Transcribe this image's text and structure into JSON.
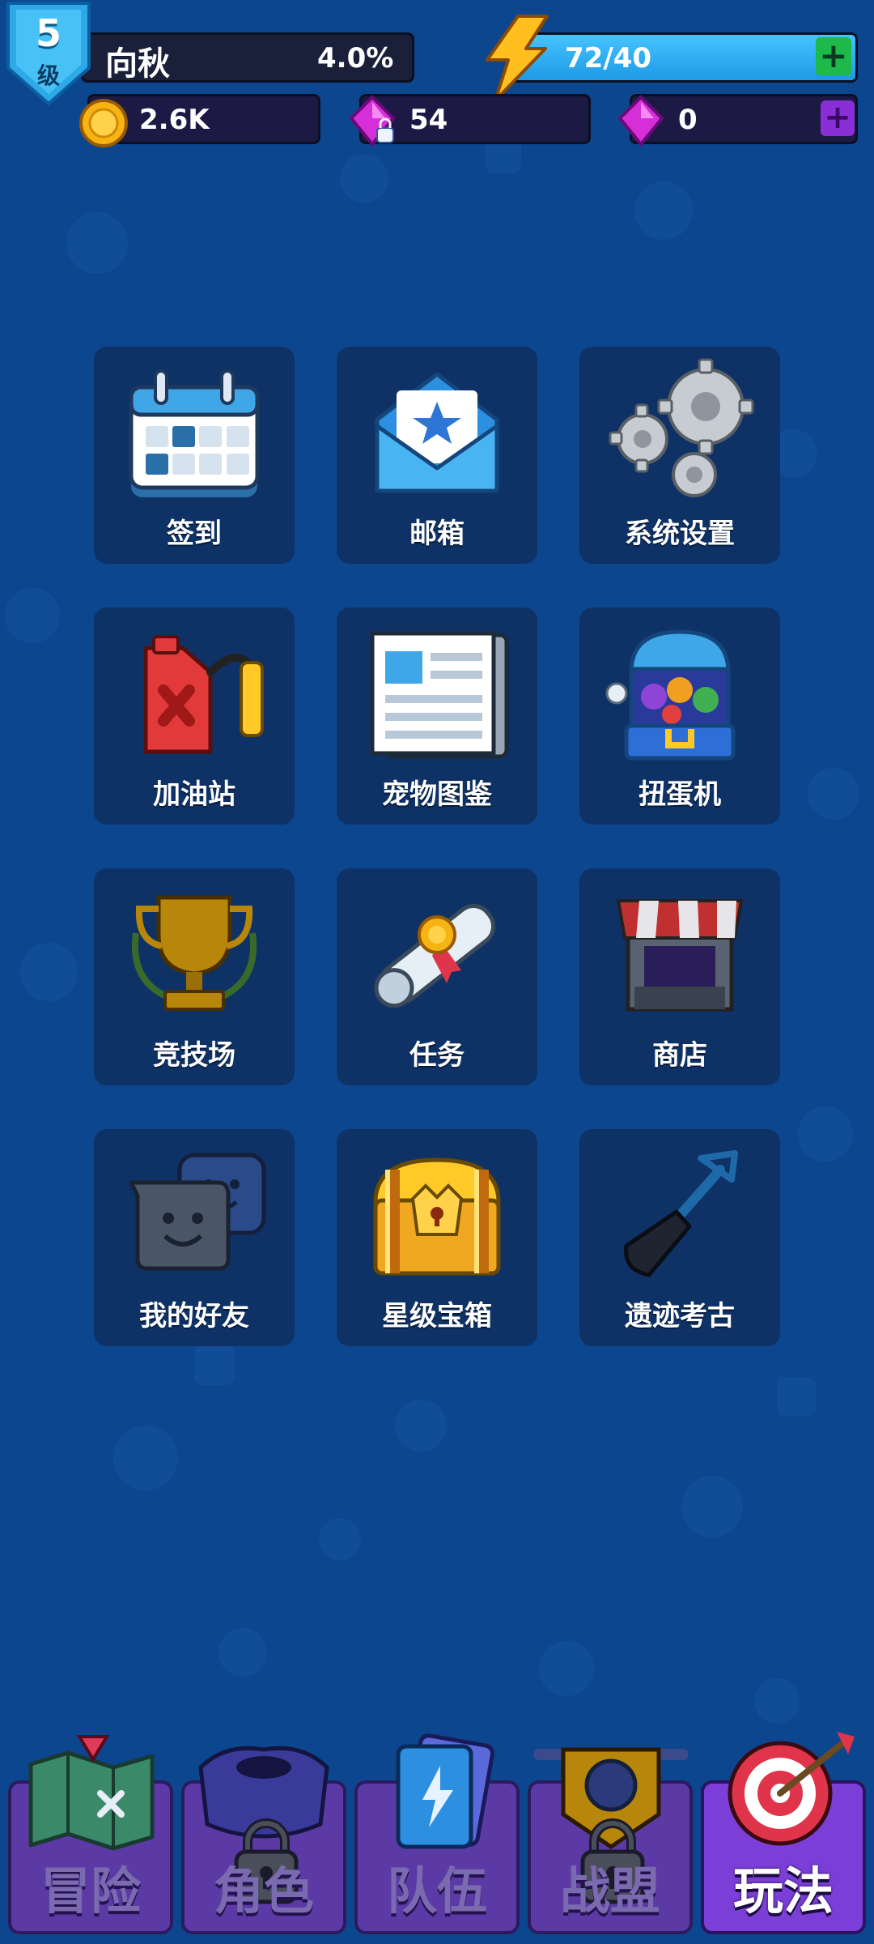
{
  "player": {
    "level": "5",
    "level_unit": "级",
    "name": "向秋",
    "progress": "4.0%"
  },
  "energy": {
    "value": "72/40",
    "plus_label": "+"
  },
  "resources": {
    "coins": "2.6K",
    "locked_gems": "54",
    "gems": "0",
    "gems_plus_label": "+"
  },
  "menu": {
    "items": [
      {
        "label": "签到",
        "icon": "calendar-icon"
      },
      {
        "label": "邮箱",
        "icon": "mail-icon"
      },
      {
        "label": "系统设置",
        "icon": "gears-icon"
      },
      {
        "label": "加油站",
        "icon": "fuel-can-icon"
      },
      {
        "label": "宠物图鉴",
        "icon": "newspaper-icon"
      },
      {
        "label": "扭蛋机",
        "icon": "gacha-machine-icon"
      },
      {
        "label": "竞技场",
        "icon": "trophy-icon"
      },
      {
        "label": "任务",
        "icon": "scroll-icon"
      },
      {
        "label": "商店",
        "icon": "shop-icon"
      },
      {
        "label": "我的好友",
        "icon": "friends-chat-icon"
      },
      {
        "label": "星级宝箱",
        "icon": "treasure-chest-icon"
      },
      {
        "label": "遗迹考古",
        "icon": "shovel-icon"
      }
    ]
  },
  "nav": {
    "tabs": [
      {
        "label": "冒险",
        "icon": "map-icon",
        "locked": false
      },
      {
        "label": "角色",
        "icon": "armor-icon",
        "locked": true
      },
      {
        "label": "队伍",
        "icon": "cards-icon",
        "locked": false
      },
      {
        "label": "战盟",
        "icon": "shield-emblem-icon",
        "locked": true
      },
      {
        "label": "玩法",
        "icon": "target-icon",
        "locked": false,
        "active": true
      }
    ]
  },
  "colors": {
    "background": "#0c468f",
    "tile": "#0e3266",
    "energy_fill": "#1e9ae6",
    "nav_tab": "#5c3aa6",
    "nav_tab_active": "#7b3fd8"
  }
}
